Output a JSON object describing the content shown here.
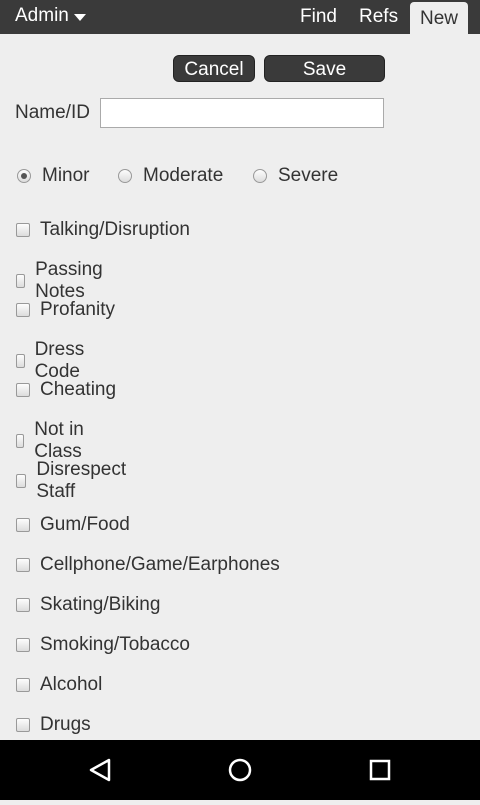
{
  "topbar": {
    "menu_label": "Admin",
    "nav": {
      "find": "Find",
      "refs": "Refs",
      "new": "New"
    }
  },
  "form": {
    "cancel_label": "Cancel",
    "save_label": "Save",
    "name_label": "Name/ID",
    "name_value": "",
    "severity": {
      "options": [
        "Minor",
        "Moderate",
        "Severe"
      ],
      "selected": "Minor"
    },
    "offenses_group1": [
      "Talking/Disruption",
      "Passing Notes",
      "Profanity",
      "Dress Code",
      "Cheating",
      "Not in Class",
      "Disrespect Staff"
    ],
    "offenses_group2": [
      "Gum/Food",
      "Cellphone/Game/Earphones",
      "Skating/Biking",
      "Smoking/Tobacco",
      "Alcohol",
      "Drugs"
    ]
  },
  "system_nav": {
    "back_icon": "back-triangle-icon",
    "home_icon": "home-circle-icon",
    "recent_icon": "recent-square-icon"
  }
}
